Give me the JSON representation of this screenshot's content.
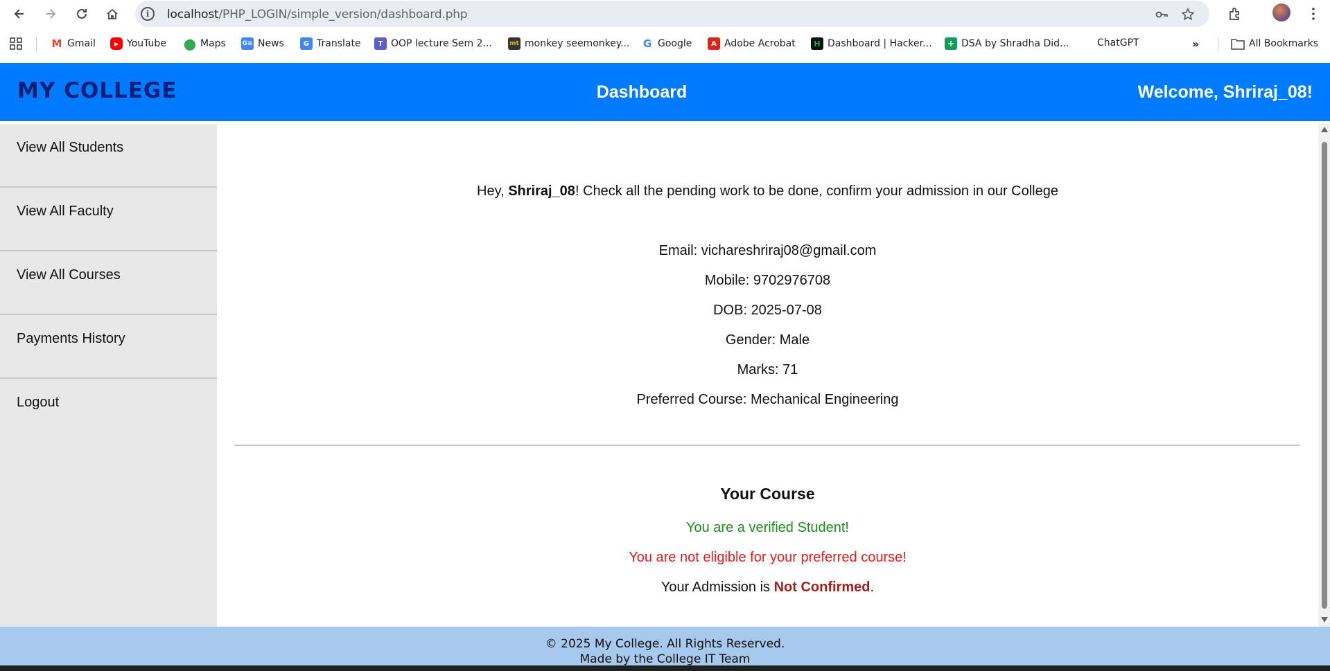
{
  "browser": {
    "url_host": "localhost",
    "url_path": "/PHP_LOGIN/simple_version/dashboard.php",
    "bookmarks": [
      {
        "label": "Gmail",
        "icon": "gmail-icon",
        "color": "#ea4335"
      },
      {
        "label": "YouTube",
        "icon": "youtube-icon",
        "color": "#ff0000"
      },
      {
        "label": "Maps",
        "icon": "maps-icon",
        "color": "#34a853"
      },
      {
        "label": "News",
        "icon": "news-icon",
        "color": "#4285f4"
      },
      {
        "label": "Translate",
        "icon": "translate-icon",
        "color": "#4285f4"
      },
      {
        "label": "OOP lecture Sem 2...",
        "icon": "teams-icon",
        "color": "#5b5fc7"
      },
      {
        "label": "monkey seemonkey...",
        "icon": "monkeytype-icon",
        "color": "#323437"
      },
      {
        "label": "Google",
        "icon": "google-icon",
        "color": "#4285f4"
      },
      {
        "label": "Adobe Acrobat",
        "icon": "acrobat-icon",
        "color": "#d9261c"
      },
      {
        "label": "Dashboard | Hacker...",
        "icon": "hackerrank-icon",
        "color": "#1ba94c"
      },
      {
        "label": "DSA by Shradha Did...",
        "icon": "sheets-icon",
        "color": "#0f9d58"
      },
      {
        "label": "ChatGPT",
        "icon": "",
        "color": ""
      }
    ],
    "all_bookmarks_label": "All Bookmarks"
  },
  "header": {
    "logo": "MY COLLEGE",
    "title": "Dashboard",
    "welcome_prefix": "Welcome, ",
    "username": "Shriraj_08",
    "welcome_suffix": "!"
  },
  "sidebar": {
    "items": [
      {
        "label": "View All Students"
      },
      {
        "label": "View All Faculty"
      },
      {
        "label": "View All Courses"
      },
      {
        "label": "Payments History"
      },
      {
        "label": "Logout"
      }
    ]
  },
  "main": {
    "greet_prefix": "Hey, ",
    "username": "Shriraj_08",
    "greet_suffix": "! Check all the pending work to be done, confirm your admission in our College",
    "details": {
      "email": "Email: vichareshriraj08@gmail.com",
      "mobile": "Mobile: 9702976708",
      "dob": "DOB: 2025-07-08",
      "gender": "Gender: Male",
      "marks": "Marks: 71",
      "preferred_course": "Preferred Course: Mechanical Engineering"
    },
    "course_section": {
      "title": "Your Course",
      "verified": "You are a verified Student!",
      "not_eligible": "You are not eligible for your preferred course!",
      "admission_prefix": "Your Admission is ",
      "admission_status": "Not Confirmed",
      "admission_suffix": "."
    }
  },
  "footer": {
    "copyright": "© 2025 My College. All Rights Reserved.",
    "credit": "Made by the College IT Team"
  },
  "colors": {
    "header_bg": "#007bff",
    "logo": "#0b1e78",
    "sidebar_bg": "#e8e8e8",
    "footer_bg": "#a8c9ee",
    "verified": "#1e8b1e",
    "not_eligible": "#e81a1a",
    "not_confirmed": "#a31e1e"
  }
}
